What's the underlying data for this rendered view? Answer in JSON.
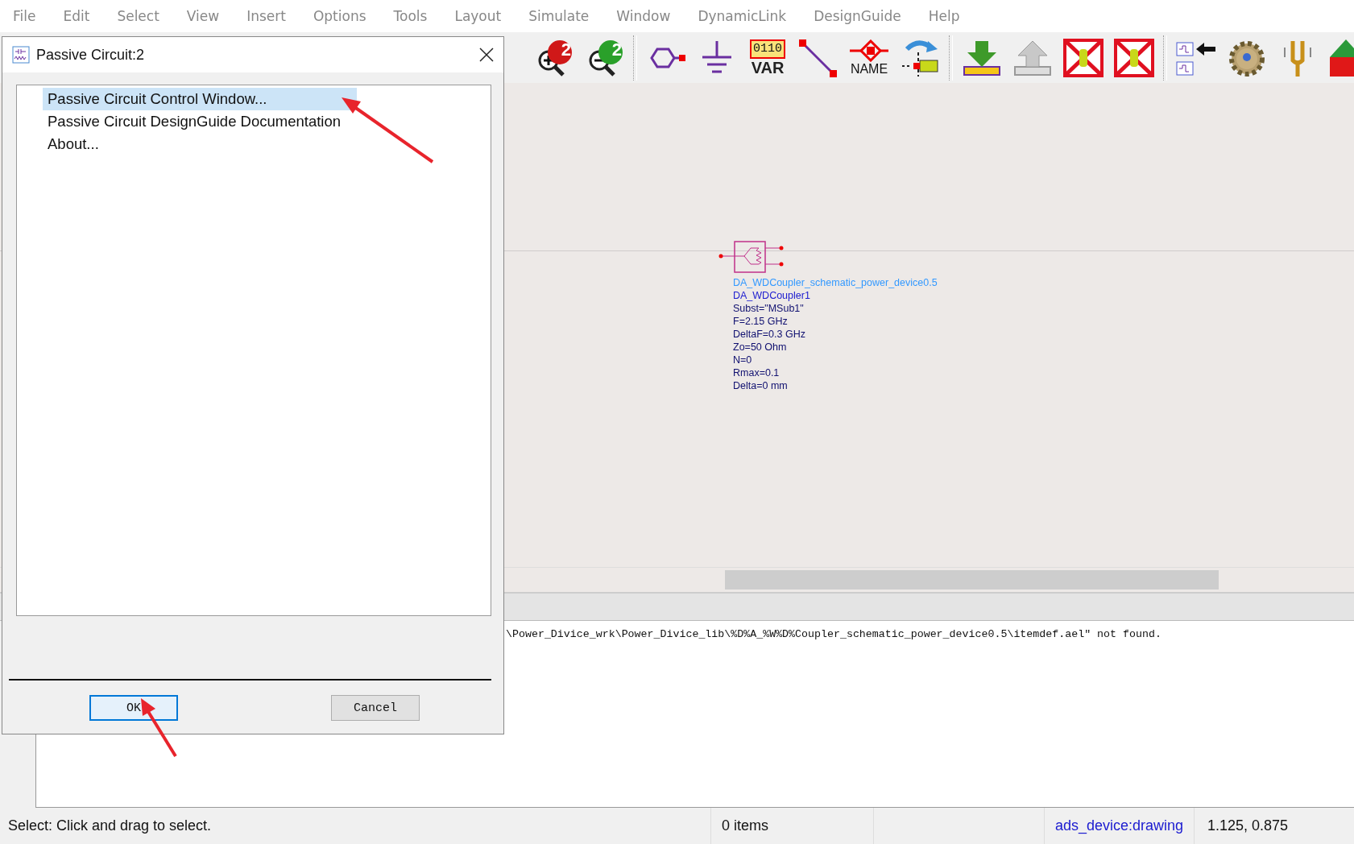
{
  "menu": [
    "File",
    "Edit",
    "Select",
    "View",
    "Insert",
    "Options",
    "Tools",
    "Layout",
    "Simulate",
    "Window",
    "DynamicLink",
    "DesignGuide",
    "Help"
  ],
  "toolbar": [
    {
      "kind": "zoom-in",
      "label": "2"
    },
    {
      "kind": "zoom-out",
      "label": "2"
    },
    {
      "kind": "separator"
    },
    {
      "kind": "port"
    },
    {
      "kind": "ground"
    },
    {
      "kind": "var",
      "label": "0110",
      "caption": "VAR"
    },
    {
      "kind": "wire"
    },
    {
      "kind": "name",
      "caption": "NAME"
    },
    {
      "kind": "pin"
    },
    {
      "kind": "separator"
    },
    {
      "kind": "push-down"
    },
    {
      "kind": "pop-up"
    },
    {
      "kind": "deactivate"
    },
    {
      "kind": "deactivate"
    },
    {
      "kind": "separator"
    },
    {
      "kind": "schematic-link"
    },
    {
      "kind": "gear"
    },
    {
      "kind": "tune"
    },
    {
      "kind": "simulate"
    }
  ],
  "schematic": {
    "component": {
      "lines": [
        {
          "kind": "design",
          "text": "DA_WDCoupler_schematic_power_device0.5"
        },
        {
          "kind": "instance",
          "text": "DA_WDCoupler1"
        },
        {
          "kind": "param",
          "text": "Subst=\"MSub1\""
        },
        {
          "kind": "param",
          "text": "F=2.15 GHz"
        },
        {
          "kind": "param",
          "text": "DeltaF=0.3 GHz"
        },
        {
          "kind": "param",
          "text": "Zo=50 Ohm"
        },
        {
          "kind": "param",
          "text": "N=0"
        },
        {
          "kind": "param",
          "text": "Rmax=0.1"
        },
        {
          "kind": "param",
          "text": "Delta=0 mm"
        }
      ]
    }
  },
  "message_log": {
    "lines": [
      "\\Power_Divice_wrk\\Power_Divice_lib\\%D%A_%W%D%Coupler_schematic_power_device0.5\\itemdef.ael″ not found."
    ]
  },
  "status_bar": [
    {
      "kind": "plain",
      "text": "Select: Click and drag to select."
    },
    {
      "kind": "plain",
      "text": "0 items"
    },
    {
      "kind": "link",
      "text": "ads_device:drawing"
    },
    {
      "kind": "plain",
      "text": "1.125, 0.875"
    }
  ],
  "dialog": {
    "title": "Passive Circuit:2",
    "items": [
      {
        "label": "Passive Circuit Control Window...",
        "selected": true
      },
      {
        "label": "Passive Circuit DesignGuide Documentation",
        "selected": false
      },
      {
        "label": "About...",
        "selected": false
      }
    ],
    "buttons": [
      {
        "kind": "default",
        "label": "OK"
      },
      {
        "kind": "normal",
        "label": "Cancel"
      }
    ]
  }
}
